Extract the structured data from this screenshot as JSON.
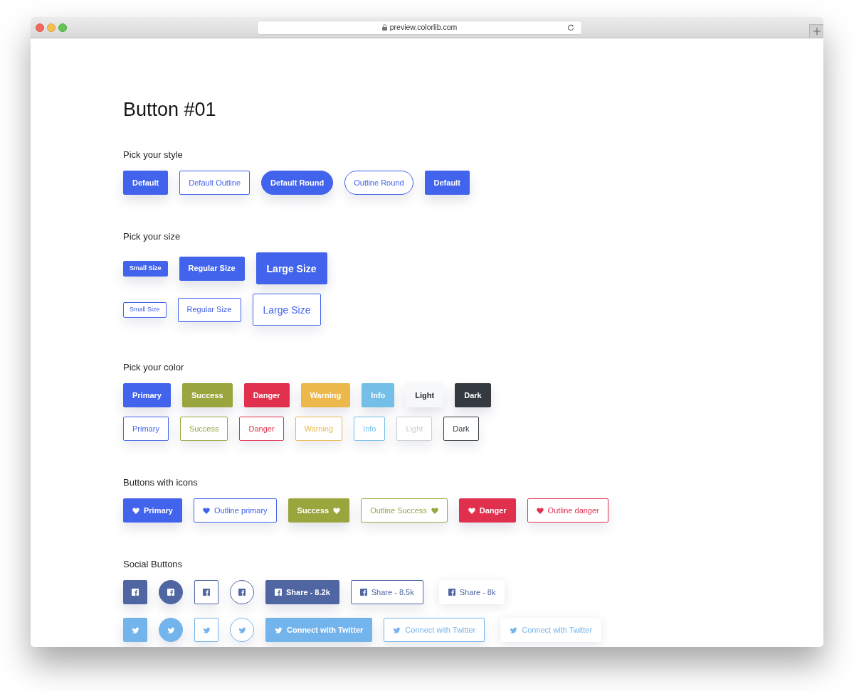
{
  "browser": {
    "url": "preview.colorlib.com"
  },
  "page": {
    "title": "Button #01"
  },
  "sections": [
    {
      "heading": "Pick your style",
      "kind": "style",
      "rows": [
        {
          "buttons": [
            {
              "label": "Default",
              "kind": "solid",
              "color": "#4263eb"
            },
            {
              "label": "Default Outline",
              "kind": "outline",
              "color": "#4263eb"
            },
            {
              "label": "Default Round",
              "kind": "pill",
              "color": "#4263eb"
            },
            {
              "label": "Outline Round",
              "kind": "outlinepill",
              "color": "#4263eb"
            },
            {
              "label": "Default",
              "kind": "solid",
              "color": "#4263eb"
            }
          ]
        }
      ]
    },
    {
      "heading": "Pick your size",
      "kind": "size",
      "rows": [
        {
          "buttons": [
            {
              "label": "Small Size",
              "kind": "solid",
              "color": "#4263eb"
            },
            {
              "label": "Regular Size",
              "kind": "solid",
              "color": "#4263eb"
            },
            {
              "label": "Large Size",
              "kind": "solid",
              "color": "#4263eb"
            }
          ]
        },
        {
          "buttons": [
            {
              "label": "Small Size",
              "kind": "outline",
              "color": "#4263eb"
            },
            {
              "label": "Regular Size",
              "kind": "outline",
              "color": "#4263eb"
            },
            {
              "label": "Large Size",
              "kind": "outline",
              "color": "#4263eb"
            }
          ]
        }
      ]
    },
    {
      "heading": "Pick your color",
      "kind": "color",
      "rows": [
        {
          "buttons": [
            {
              "label": "Primary",
              "kind": "solid",
              "color": "#4263eb"
            },
            {
              "label": "Success",
              "kind": "solid",
              "color": "#98a63d"
            },
            {
              "label": "Danger",
              "kind": "solid",
              "color": "#e0304e"
            },
            {
              "label": "Warning",
              "kind": "solid",
              "color": "#ecb84b"
            },
            {
              "label": "Info",
              "kind": "solid",
              "color": "#73bfe8"
            },
            {
              "label": "Light",
              "kind": "solid",
              "color": "#f7f8fa"
            },
            {
              "label": "Dark",
              "kind": "solid",
              "color": "#343a40"
            }
          ]
        },
        {
          "buttons": [
            {
              "label": "Primary",
              "kind": "outline",
              "color": "#4263eb"
            },
            {
              "label": "Success",
              "kind": "outline",
              "color": "#98a63d"
            },
            {
              "label": "Danger",
              "kind": "outline",
              "color": "#e0304e"
            },
            {
              "label": "Warning",
              "kind": "outline",
              "color": "#ecb84b"
            },
            {
              "label": "Info",
              "kind": "outline",
              "color": "#73bfe8"
            },
            {
              "label": "Light",
              "kind": "outline",
              "color": "#c9cdd3"
            },
            {
              "label": "Dark",
              "kind": "outline",
              "color": "#343a40"
            }
          ]
        }
      ]
    },
    {
      "heading": "Buttons with icons",
      "kind": "icons",
      "rows": [
        {
          "buttons": [
            {
              "label": "Primary",
              "kind": "solid",
              "color": "#4263eb"
            },
            {
              "label": "Outline primary",
              "kind": "outline",
              "color": "#4263eb"
            },
            {
              "label": "Success",
              "kind": "solid",
              "color": "#98a63d"
            },
            {
              "label": "Outline Success",
              "kind": "outline",
              "color": "#98a63d"
            },
            {
              "label": "Danger",
              "kind": "solid",
              "color": "#e0304e"
            },
            {
              "label": "Outline danger",
              "kind": "outline",
              "color": "#e0304e"
            }
          ]
        }
      ]
    },
    {
      "heading": "Social Buttons",
      "kind": "social",
      "rows": [
        {
          "buttons": [
            {
              "kind": "tile",
              "color": "#4f66a2"
            },
            {
              "kind": "disc",
              "color": "#4f66a2"
            },
            {
              "kind": "frame",
              "color": "#4f66a2"
            },
            {
              "kind": "ring",
              "color": "#4f66a2"
            },
            {
              "label": "Share - 8.2k",
              "kind": "solid",
              "color": "#4f66a2"
            },
            {
              "label": "Share - 8.5k",
              "kind": "outline",
              "color": "#4f66a2"
            },
            {
              "label": "Share - 8k",
              "kind": "shadow",
              "color": "#4f66a2"
            }
          ]
        },
        {
          "buttons": [
            {
              "kind": "tile",
              "color": "#74b4ec"
            },
            {
              "kind": "disc",
              "color": "#74b4ec"
            },
            {
              "kind": "frame",
              "color": "#74b4ec"
            },
            {
              "kind": "ring",
              "color": "#74b4ec"
            },
            {
              "label": "Connect with Twitter",
              "kind": "solid",
              "color": "#74b4ec"
            },
            {
              "label": "Connect with Twitter",
              "kind": "outline",
              "color": "#74b4ec"
            },
            {
              "label": "Connect with Twitter",
              "kind": "shadow",
              "color": "#74b4ec"
            }
          ]
        }
      ]
    }
  ]
}
